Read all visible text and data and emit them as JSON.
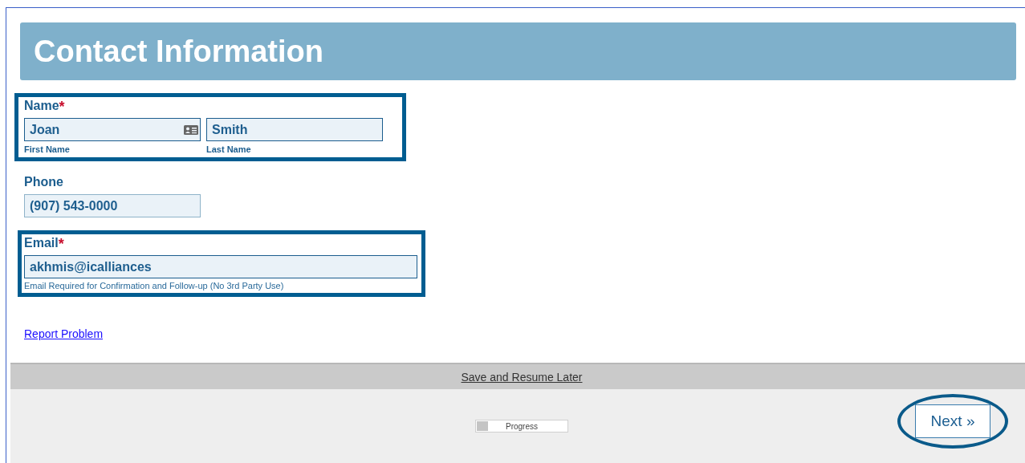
{
  "header": {
    "title": "Contact Information"
  },
  "name": {
    "label": "Name",
    "required_mark": "*",
    "highlighted": true,
    "fields": [
      {
        "value": "Joan",
        "caption": "First Name",
        "kind": "contact"
      },
      {
        "value": "Smith",
        "caption": "Last Name",
        "kind": "plain"
      }
    ]
  },
  "phone": {
    "label": "Phone",
    "value": "(907) 543-0000",
    "highlighted": false
  },
  "email": {
    "label": "Email",
    "required_mark": "*",
    "value": "akhmis@icalliances",
    "hint": "Email Required for Confirmation and Follow-up (No 3rd Party Use)",
    "highlighted": true
  },
  "report_link": "Report Problem",
  "save_bar": {
    "link": "Save and Resume Later"
  },
  "progress": {
    "label": "Progress",
    "level": 0.12
  },
  "next_button": {
    "label": "Next »",
    "highlighted": true
  }
}
